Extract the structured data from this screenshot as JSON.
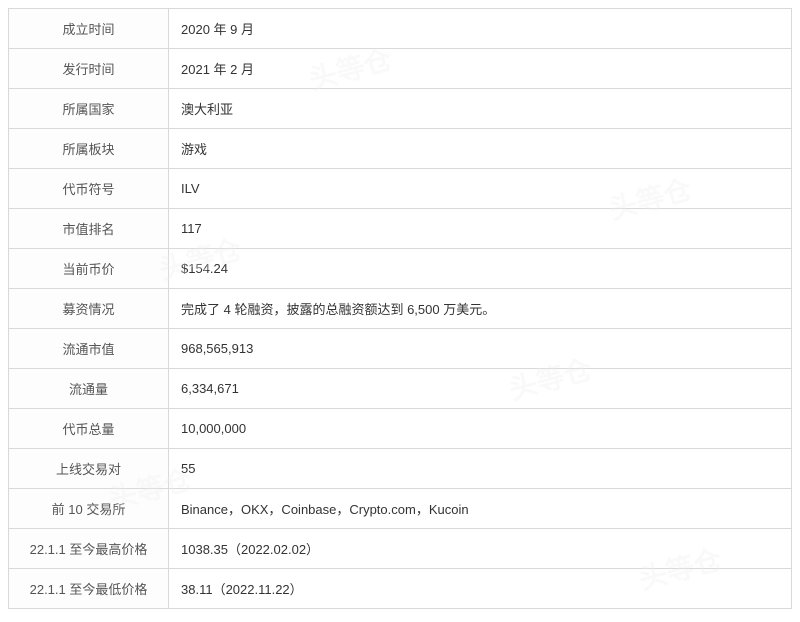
{
  "rows": [
    {
      "label": "成立时间",
      "value": "2020 年 9 月"
    },
    {
      "label": "发行时间",
      "value": "2021 年 2 月"
    },
    {
      "label": "所属国家",
      "value": "澳大利亚"
    },
    {
      "label": "所属板块",
      "value": "游戏"
    },
    {
      "label": "代币符号",
      "value": "ILV"
    },
    {
      "label": "市值排名",
      "value": "117"
    },
    {
      "label": "当前币价",
      "value": "$154.24"
    },
    {
      "label": "募资情况",
      "value": "完成了 4 轮融资，披露的总融资额达到 6,500 万美元。"
    },
    {
      "label": "流通市值",
      "value": "968,565,913"
    },
    {
      "label": "流通量",
      "value": "6,334,671"
    },
    {
      "label": "代币总量",
      "value": "10,000,000"
    },
    {
      "label": "上线交易对",
      "value": "55"
    },
    {
      "label": "前 10 交易所",
      "value": "Binance，OKX，Coinbase，Crypto.com，Kucoin"
    },
    {
      "label": "22.1.1 至今最高价格",
      "value": "1038.35（2022.02.02）"
    },
    {
      "label": "22.1.1 至今最低价格",
      "value": "38.11（2022.11.22）"
    }
  ],
  "watermark_text": "头等仓"
}
